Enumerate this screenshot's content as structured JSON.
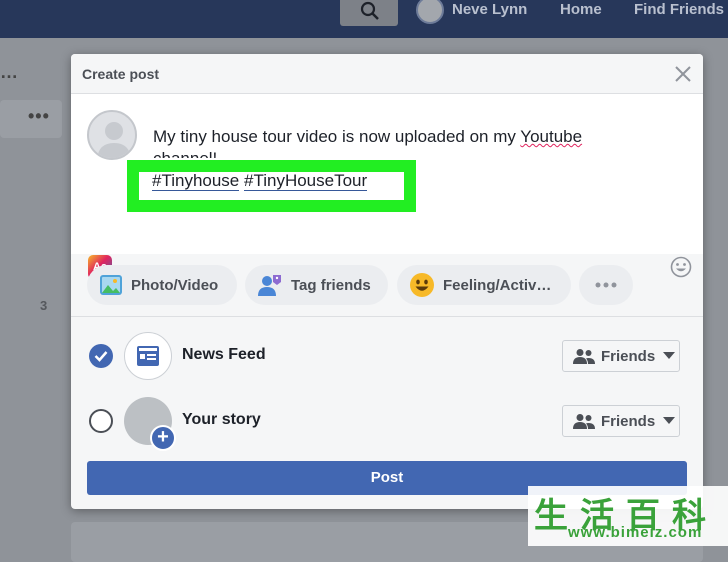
{
  "topbar": {
    "user_name": "Neve Lynn",
    "home_label": "Home",
    "find_friends_label": "Find Friends"
  },
  "background": {
    "side_count": "3"
  },
  "dialog": {
    "title": "Create post",
    "post_text_line1": "My tiny house tour video is now uploaded on my ",
    "post_text_link": "Youtube",
    "post_text_line2": "channel!",
    "hashtag1": "#Tinyhouse",
    "hashtag2": "#TinyHouseTour",
    "text_format_label": "Aa",
    "actions": {
      "photo_video": "Photo/Video",
      "tag_friends": "Tag friends",
      "feeling": "Feeling/Activ…"
    },
    "audience": {
      "news_feed_label": "News Feed",
      "news_feed_privacy": "Friends",
      "story_label": "Your story",
      "story_privacy": "Friends"
    },
    "post_button": "Post"
  },
  "watermark": {
    "chars": "生活百科",
    "url": "www.bimeiz.com"
  },
  "colors": {
    "facebook_blue": "#4267b2",
    "highlight_green": "#22ee22",
    "overlay_bg": "#8f9399"
  }
}
